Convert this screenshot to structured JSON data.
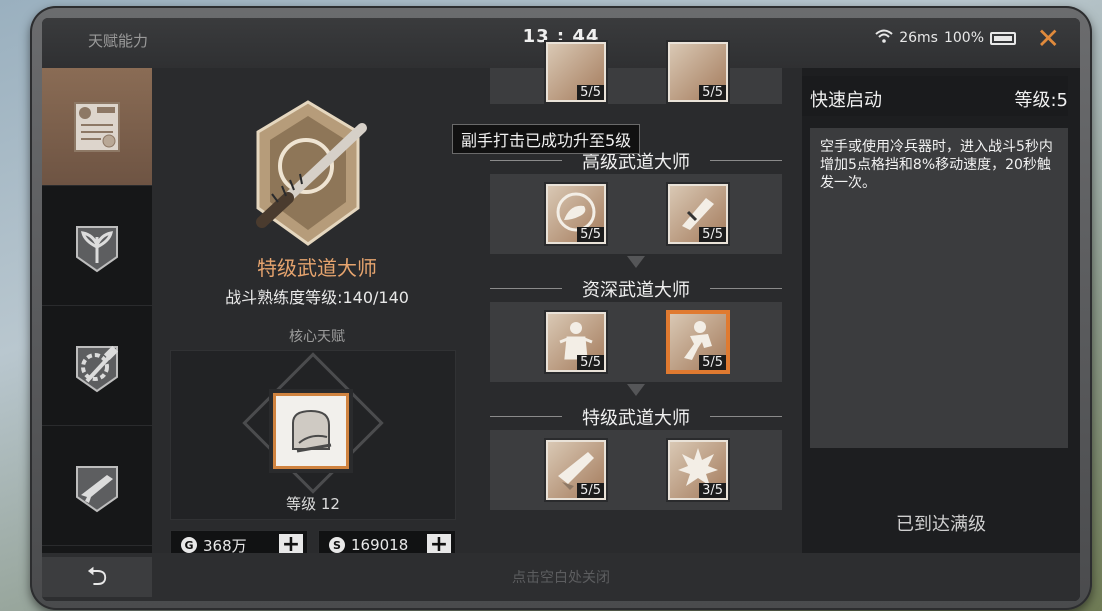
{
  "status": {
    "title": "天赋能力",
    "time": "13 : 44",
    "ping": "26ms",
    "battery": "100%",
    "close_glyph": "✕"
  },
  "nav": {
    "items": [
      {
        "name": "trade-certificate-icon"
      },
      {
        "name": "plant-icon"
      },
      {
        "name": "gear-hammer-icon"
      },
      {
        "name": "firearm-icon"
      }
    ],
    "active_index": 0
  },
  "talent": {
    "title": "特级武道大师",
    "level_text": "战斗熟练度等级:140/140",
    "core_label": "核心天赋",
    "core_level": "等级 12"
  },
  "currency": {
    "coin": "368万",
    "coin_icon": "G",
    "credits": "169018",
    "credits_icon": "S",
    "plus_glyph": "+"
  },
  "toast": "副手打击已成功升至5级",
  "tree": {
    "top_counts": [
      "5/5",
      "5/5"
    ],
    "tiers": [
      {
        "title": "高级武道大师",
        "skills": [
          {
            "count": "5/5"
          },
          {
            "count": "5/5"
          }
        ]
      },
      {
        "title": "资深武道大师",
        "skills": [
          {
            "count": "5/5"
          },
          {
            "count": "5/5",
            "selected": true
          }
        ]
      },
      {
        "title": "特级武道大师",
        "skills": [
          {
            "count": "5/5"
          },
          {
            "count": "3/5"
          }
        ]
      }
    ]
  },
  "detail": {
    "name": "快速启动",
    "level": "等级:5",
    "description": "空手或使用冷兵器时，进入战斗5秒内增加5点格挡和8%移动速度，20秒触发一次。",
    "max_text": "已到达满级"
  },
  "bottom": {
    "back_glyph": "⮌",
    "close_hint": "点击空白处关闭"
  },
  "colors": {
    "accent": "#e07a30",
    "title_orange": "#e6a46e"
  }
}
